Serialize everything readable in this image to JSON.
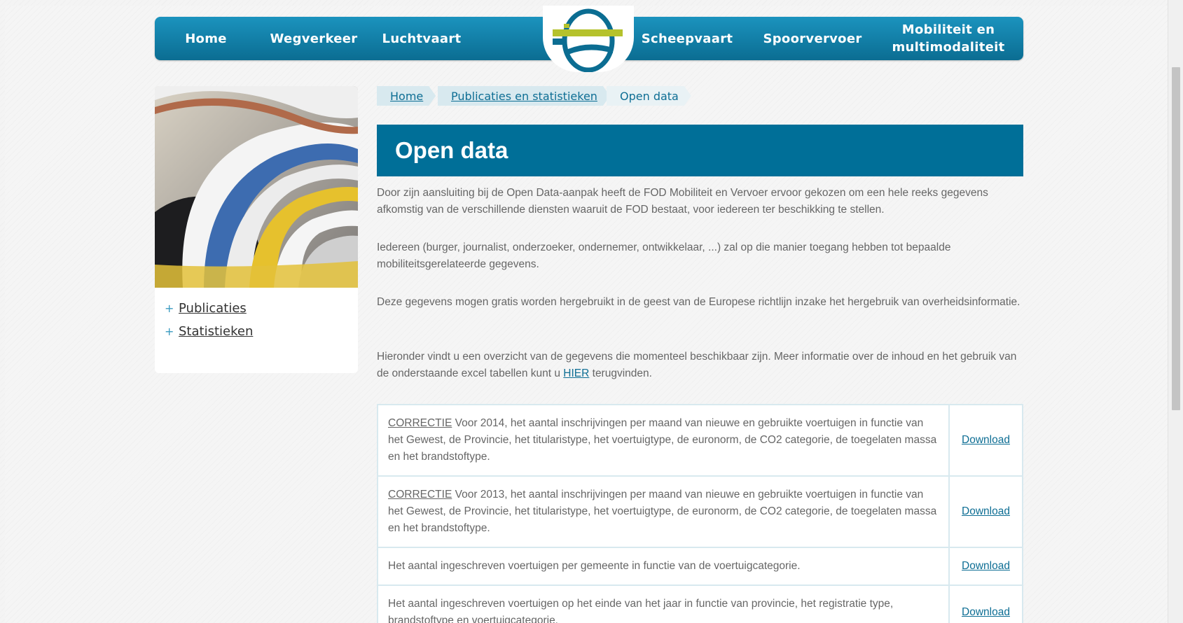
{
  "nav": {
    "items": [
      {
        "label": "Home"
      },
      {
        "label": "Wegverkeer"
      },
      {
        "label": "Luchtvaart"
      },
      {
        "label": "Scheepvaart"
      },
      {
        "label": "Spoorvervoer"
      },
      {
        "label": "Mobiliteit en multimodaliteit"
      }
    ]
  },
  "sidebar": {
    "links": [
      {
        "label": "Publicaties"
      },
      {
        "label": "Statistieken"
      }
    ]
  },
  "breadcrumb": [
    {
      "label": "Home"
    },
    {
      "label": "Publicaties en statistieken"
    },
    {
      "label": "Open data"
    }
  ],
  "page": {
    "title": "Open data",
    "paragraphs": [
      "Door zijn aansluiting bij de Open Data-aanpak heeft de FOD Mobiliteit en Vervoer ervoor gekozen om een hele reeks gegevens afkomstig van de verschillende diensten waaruit de FOD bestaat, voor iedereen ter beschikking te stellen.",
      "Iedereen (burger, journalist, onderzoeker, ondernemer, ontwikkelaar, ...) zal op die manier toegang hebben tot bepaalde mobiliteitsgerelateerde gegevens.",
      "Deze gegevens mogen gratis worden hergebruikt in de geest van de Europese richtlijn inzake het hergebruik van overheidsinformatie."
    ],
    "info_before": "Hieronder vindt u een overzicht van de gegevens die momenteel beschikbaar zijn. Meer informatie over de inhoud en het gebruik van de onderstaande excel tabellen kunt u ",
    "info_link": "HIER",
    "info_after": " terugvinden."
  },
  "table": {
    "rows": [
      {
        "tag": "CORRECTIE",
        "text": " Voor 2014, het aantal inschrijvingen per maand van nieuwe en gebruikte voertuigen in functie van het Gewest, de Provincie, het titularistype, het voertuigtype, de euronorm, de CO2 categorie, de toegelaten massa en het brandstoftype.",
        "action": "Download"
      },
      {
        "tag": "CORRECTIE",
        "text": " Voor 2013, het aantal inschrijvingen per maand van nieuwe en gebruikte voertuigen in functie van het Gewest, de Provincie, het titularistype, het voertuigtype, de euronorm, de CO2 categorie, de toegelaten massa en het brandstoftype.",
        "action": "Download"
      },
      {
        "tag": "",
        "text": "Het aantal ingeschreven voertuigen per gemeente in functie van de voertuigcategorie.",
        "action": "Download"
      },
      {
        "tag": "",
        "text": "Het aantal ingeschreven voertuigen op het einde van het jaar in functie van provincie, het registratie type, brandstoftype en voertuigcategorie.",
        "action": "Download"
      }
    ]
  },
  "colors": {
    "nav_blue": "#1b93be",
    "title_blue": "#006f98",
    "link_blue": "#0e6e94",
    "logo_green": "#b5c22c",
    "border": "#d8e9ef"
  }
}
